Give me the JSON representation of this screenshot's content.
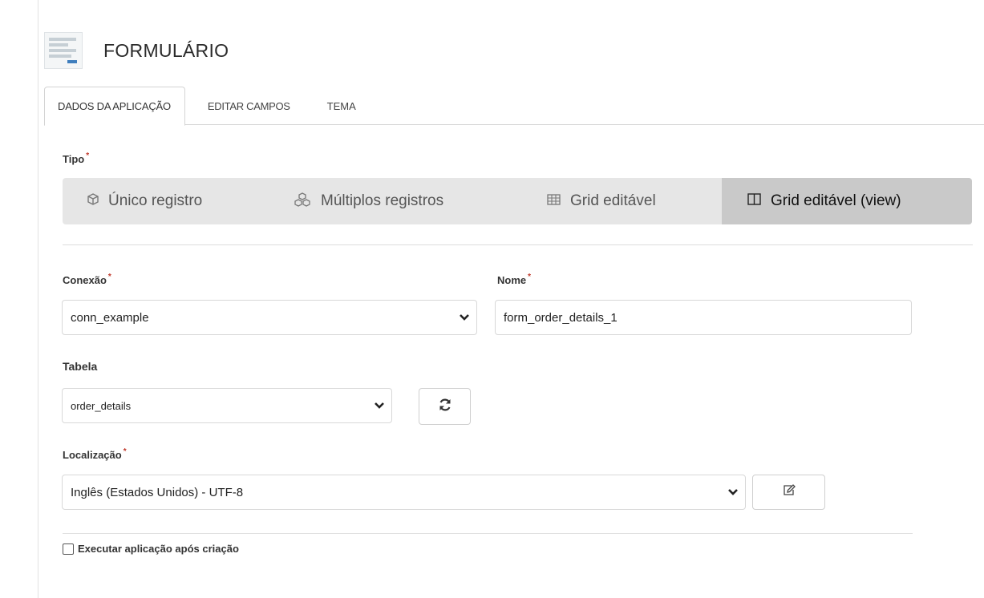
{
  "header": {
    "title": "FORMULÁRIO",
    "icon": "form-icon"
  },
  "tabs": [
    {
      "label": "DADOS DA APLICAÇÃO",
      "active": true
    },
    {
      "label": "EDITAR CAMPOS",
      "active": false
    },
    {
      "label": "TEMA",
      "active": false
    }
  ],
  "tipo": {
    "label": "Tipo",
    "required_mark": "*",
    "options": [
      {
        "label": "Único registro",
        "icon": "cube-icon",
        "selected": false
      },
      {
        "label": "Múltiplos registros",
        "icon": "cubes-icon",
        "selected": false
      },
      {
        "label": "Grid editável",
        "icon": "table-icon",
        "selected": false
      },
      {
        "label": "Grid editável (view)",
        "icon": "columns-icon",
        "selected": true
      }
    ]
  },
  "conexao": {
    "label": "Conexão",
    "required_mark": "*",
    "value": "conn_example"
  },
  "nome": {
    "label": "Nome",
    "required_mark": "*",
    "value": "form_order_details_1"
  },
  "tabela": {
    "label": "Tabela",
    "value": "order_details",
    "refresh_icon": "refresh-icon"
  },
  "localizacao": {
    "label": "Localização",
    "required_mark": "*",
    "value": "Inglês (Estados Unidos) - UTF-8",
    "edit_icon": "edit-icon"
  },
  "executar": {
    "label": "Executar aplicação após criação",
    "checked": false
  },
  "colors": {
    "required": "#c0392b",
    "selected_option_bg": "#c9c9c9",
    "bar_bg": "#e6e6e6",
    "icon_accent": "#3f7ebd"
  }
}
